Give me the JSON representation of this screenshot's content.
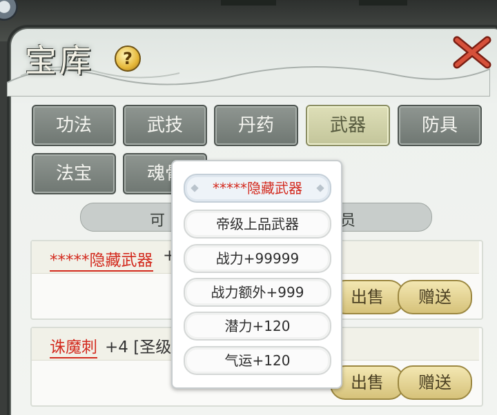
{
  "header": {
    "title": "宝库",
    "help": "?"
  },
  "tabs": [
    {
      "label": "功法",
      "active": false
    },
    {
      "label": "武技",
      "active": false
    },
    {
      "label": "丹药",
      "active": false
    },
    {
      "label": "武器",
      "active": true
    },
    {
      "label": "防具",
      "active": false
    },
    {
      "label": "法宝",
      "active": false
    },
    {
      "label": "魂骨",
      "active": false
    }
  ],
  "pill": {
    "left": "可",
    "right": "员"
  },
  "items": [
    {
      "name": "*****隐藏武器",
      "suffix": "+",
      "sell": "出售",
      "gift": "赠送"
    },
    {
      "name": "诛魔刺",
      "suffix": "+4 [圣级",
      "sell": "出售",
      "gift": "赠送"
    }
  ],
  "popup": {
    "title": "*****隐藏武器",
    "lines": [
      "帝级上品武器",
      "战力+99999",
      "战力额外+999",
      "潜力+120",
      "气运+120"
    ]
  },
  "colors": {
    "item_name": "#d32a1e",
    "active_tab": "#c3c59a",
    "button": "#d6c27a"
  }
}
